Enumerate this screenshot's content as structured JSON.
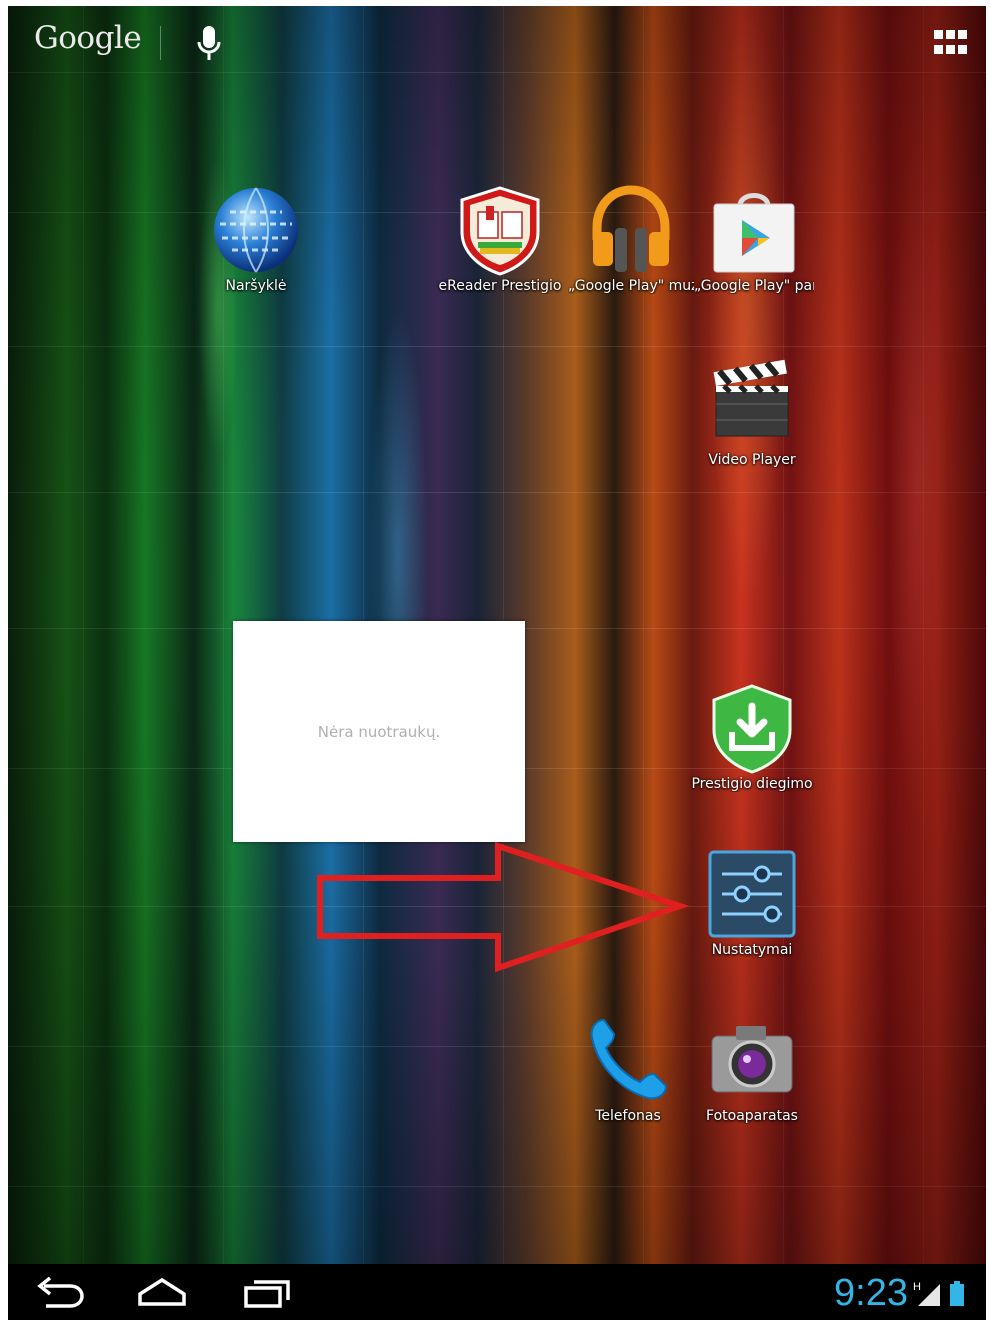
{
  "search_bar": {
    "logo_text": "Google",
    "mic": "mic-icon",
    "apps": "all-apps-icon"
  },
  "apps": [
    {
      "name": "narsykle",
      "label": "Naršyklė",
      "icon": "browser-globe-icon"
    },
    {
      "name": "ereader-prestigio",
      "label": "eReader Prestigio",
      "icon": "ereader-book-shield-icon"
    },
    {
      "name": "google-play-music",
      "label": "„Google Play\" muzika",
      "icon": "headphones-icon"
    },
    {
      "name": "google-play-store",
      "label": "„Google Play\" parduotuvė",
      "icon": "play-store-bag-icon"
    },
    {
      "name": "video-player",
      "label": "Video Player",
      "icon": "clapperboard-icon"
    },
    {
      "name": "prestigio-installer",
      "label": "Prestigio diegimo",
      "icon": "download-shield-icon"
    },
    {
      "name": "settings",
      "label": "Nustatymai",
      "icon": "settings-sliders-icon"
    },
    {
      "name": "phone",
      "label": "Telefonas",
      "icon": "phone-handset-icon"
    },
    {
      "name": "camera",
      "label": "Fotoaparatas",
      "icon": "camera-icon"
    }
  ],
  "widget": {
    "empty_text": "Nėra nuotraukų."
  },
  "annotation": {
    "arrow_color": "#e02020"
  },
  "navbar": {
    "back": "back-icon",
    "home": "home-icon",
    "recents": "recents-icon",
    "clock": "9:23",
    "network_label": "H"
  },
  "colors": {
    "clock": "#33b5e5",
    "navbar": "#000000"
  }
}
